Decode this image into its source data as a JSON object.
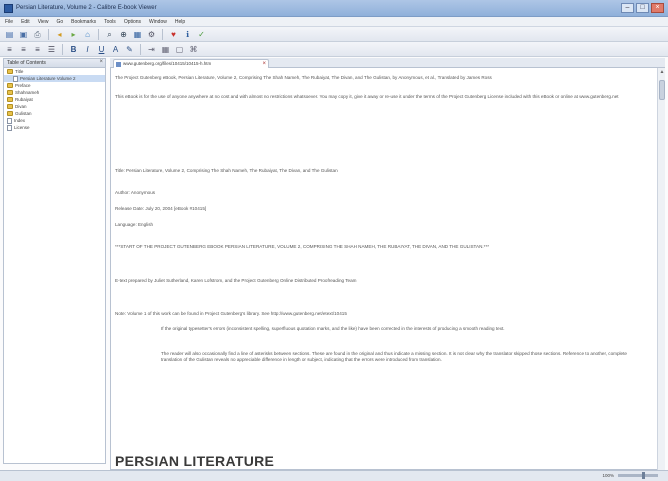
{
  "window": {
    "title": "Persian Literature, Volume 2 - Calibre E-book Viewer"
  },
  "menubar": {
    "items": [
      "File",
      "Edit",
      "View",
      "Go",
      "Bookmarks",
      "Tools",
      "Options",
      "Window",
      "Help"
    ]
  },
  "toolbar1": {
    "icons": [
      "open-icon",
      "save-icon",
      "print-icon",
      "back-icon",
      "forward-icon",
      "home-icon",
      "find-icon",
      "zoom-icon",
      "bookmark-icon",
      "settings-icon",
      "heart-icon",
      "info-icon",
      "check-icon"
    ]
  },
  "toolbar2": {
    "icons": [
      "align-left-icon",
      "align-center-icon",
      "align-right-icon",
      "bold-icon",
      "italic-icon",
      "underline-icon",
      "font-icon",
      "color-icon",
      "list-icon",
      "indent-icon",
      "table-icon",
      "image-icon",
      "link-icon"
    ]
  },
  "left_pane": {
    "header": "Table of Contents",
    "items": [
      {
        "label": "Title",
        "type": "folder",
        "selected": false
      },
      {
        "label": "Persian Literature Volume 2",
        "type": "doc",
        "selected": true
      },
      {
        "label": "Preface",
        "type": "folder",
        "selected": false
      },
      {
        "label": "Shahnameh",
        "type": "folder",
        "selected": false
      },
      {
        "label": "Rubaiyat",
        "type": "folder",
        "selected": false
      },
      {
        "label": "Divan",
        "type": "folder",
        "selected": false
      },
      {
        "label": "Gulistan",
        "type": "folder",
        "selected": false
      },
      {
        "label": "Index",
        "type": "doc",
        "selected": false
      },
      {
        "label": "License",
        "type": "doc",
        "selected": false
      }
    ]
  },
  "tab": {
    "label": "www.gutenberg.org/files/10415/10415-h.htm"
  },
  "document": {
    "para1": "The Project Gutenberg eBook, Persian Literature, Volume 2, Comprising The Shah Nameh, The Rubaiyat, The Divan, and The Gulistan, by Anonymous, et al., Translated by James Ross",
    "para2": "This eBook is for the use of anyone anywhere at no cost and with almost no restrictions whatsoever. You may copy it, give it away or re-use it under the terms of the Project Gutenberg License included with this eBook or online at www.gutenberg.net",
    "title_line": "Title: Persian Literature, Volume 2, Comprising The Shah Nameh, The Rubaiyat, The Divan, and The Gulistan",
    "author_line": "Author: Anonymous",
    "release_line": "Release Date: July 20, 2004 [eBook #10415]",
    "language_line": "Language: English",
    "start_line": "***START OF THE PROJECT GUTENBERG EBOOK PERSIAN LITERATURE, VOLUME 2, COMPRISING THE SHAH NAMEH, THE RUBAIYAT, THE DIVAN, AND THE GULISTAN.***",
    "produced_line": "E-text prepared by Juliet Sutherland, Karen Lofstrom, and the Project Gutenberg Online Distributed Proofreading Team",
    "note_line": "Note: Volume 1 of this work can be found in Project Gutenberg's library. See http://www.gutenberg.net/etext/10415",
    "indent1": "If the original typesetter's errors (inconsistent spelling, superfluous quotation marks, and the like) have been corrected in the interests of producing a smooth reading text.",
    "indent2": "The reader will also occasionally find a line of asterisks between sections. These are found in the original and thus indicate a missing section. It is not clear why the translator skipped those sections. Reference to another, complete translation of the Gulistan reveals no appreciable difference in length or subject, indicating that the errors were introduced from translation.",
    "heading": "PERSIAN LITERATURE"
  },
  "statusbar": {
    "zoom": "100%"
  }
}
